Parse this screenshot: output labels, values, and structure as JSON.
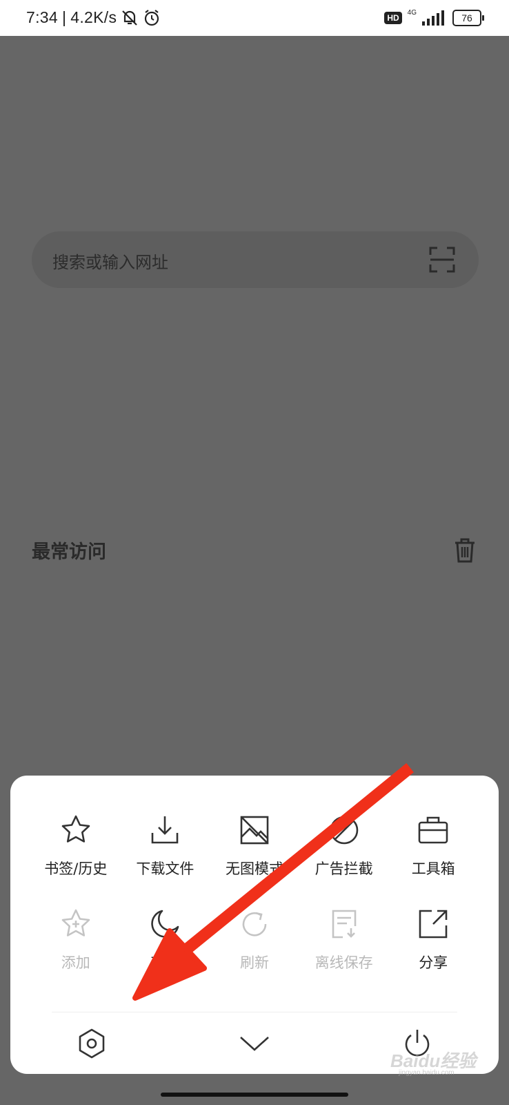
{
  "status_bar": {
    "time": "7:34",
    "separator": "|",
    "speed": "4.2K/s",
    "hd": "HD",
    "network": "4G",
    "battery": "76"
  },
  "search": {
    "placeholder": "搜索或输入网址"
  },
  "section": {
    "title": "最常访问"
  },
  "menu": {
    "row1": [
      {
        "label": "书签/历史",
        "icon": "star-icon"
      },
      {
        "label": "下载文件",
        "icon": "download-icon"
      },
      {
        "label": "无图模式",
        "icon": "no-image-icon"
      },
      {
        "label": "广告拦截",
        "icon": "ad-block-icon"
      },
      {
        "label": "工具箱",
        "icon": "toolbox-icon"
      }
    ],
    "row2": [
      {
        "label": "添加",
        "icon": "star-add-icon",
        "disabled": true
      },
      {
        "label": "夜间",
        "icon": "moon-icon"
      },
      {
        "label": "刷新",
        "icon": "refresh-icon",
        "disabled": true
      },
      {
        "label": "离线保存",
        "icon": "offline-save-icon",
        "disabled": true
      },
      {
        "label": "分享",
        "icon": "share-icon"
      }
    ]
  },
  "bottom_bar": [
    "settings-icon",
    "collapse-chevron-icon",
    "power-icon"
  ],
  "annotation": {
    "arrow_color": "#f0301a"
  },
  "watermark": {
    "brand": "Baidu经验",
    "url": "jingyan.baidu.com"
  },
  "colors": {
    "dim_overlay": "#666666",
    "sheet": "#ffffff",
    "disabled_text": "#b8b8b8"
  }
}
